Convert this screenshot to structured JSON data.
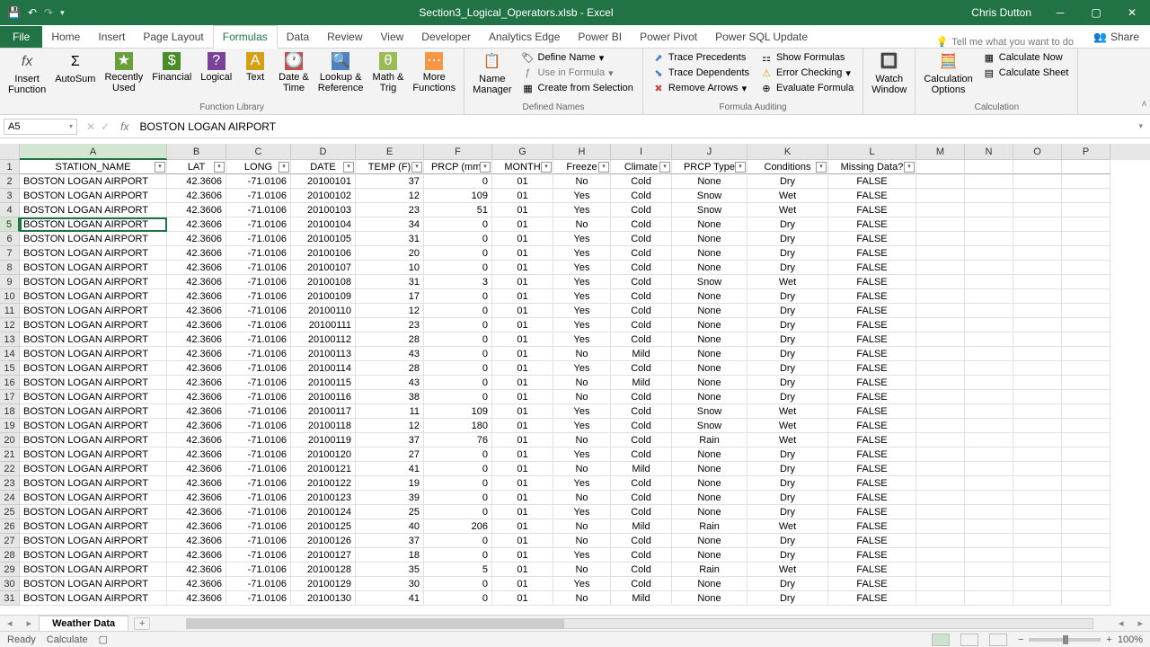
{
  "title": "Section3_Logical_Operators.xlsb - Excel",
  "user": "Chris Dutton",
  "tabs": {
    "file": "File",
    "home": "Home",
    "insert": "Insert",
    "pagelayout": "Page Layout",
    "formulas": "Formulas",
    "data": "Data",
    "review": "Review",
    "view": "View",
    "developer": "Developer",
    "analyticsedge": "Analytics Edge",
    "powerbi": "Power BI",
    "powerpivot": "Power Pivot",
    "powersql": "Power SQL Update"
  },
  "tellme": "Tell me what you want to do",
  "share": "Share",
  "ribbon": {
    "insertfn": "Insert\nFunction",
    "autosum": "AutoSum",
    "recent": "Recently\nUsed",
    "financial": "Financial",
    "logical": "Logical",
    "text": "Text",
    "datetime": "Date &\nTime",
    "lookup": "Lookup &\nReference",
    "math": "Math &\nTrig",
    "more": "More\nFunctions",
    "funclib": "Function Library",
    "namemgr": "Name\nManager",
    "defname": "Define Name",
    "useinf": "Use in Formula",
    "createsel": "Create from Selection",
    "defnames": "Defined Names",
    "traceprec": "Trace Precedents",
    "tracedep": "Trace Dependents",
    "removearr": "Remove Arrows",
    "showform": "Show Formulas",
    "errorchk": "Error Checking",
    "evalform": "Evaluate Formula",
    "formaudit": "Formula Auditing",
    "watchwin": "Watch\nWindow",
    "calcopt": "Calculation\nOptions",
    "calcnow": "Calculate Now",
    "calcsheet": "Calculate Sheet",
    "calcgrp": "Calculation"
  },
  "namebox": "A5",
  "formula": "BOSTON LOGAN AIRPORT",
  "colletters": [
    "A",
    "B",
    "C",
    "D",
    "E",
    "F",
    "G",
    "H",
    "I",
    "J",
    "K",
    "L",
    "M",
    "N",
    "O",
    "P"
  ],
  "headers": [
    "STATION_NAME",
    "LAT",
    "LONG",
    "DATE",
    "TEMP (F)",
    "PRCP (mm)",
    "MONTH",
    "Freeze",
    "Climate",
    "PRCP Type",
    "Conditions",
    "Missing Data?"
  ],
  "rows": [
    [
      "BOSTON LOGAN AIRPORT",
      "42.3606",
      "-71.0106",
      "20100101",
      "37",
      "0",
      "01",
      "No",
      "Cold",
      "None",
      "Dry",
      "FALSE"
    ],
    [
      "BOSTON LOGAN AIRPORT",
      "42.3606",
      "-71.0106",
      "20100102",
      "12",
      "109",
      "01",
      "Yes",
      "Cold",
      "Snow",
      "Wet",
      "FALSE"
    ],
    [
      "BOSTON LOGAN AIRPORT",
      "42.3606",
      "-71.0106",
      "20100103",
      "23",
      "51",
      "01",
      "Yes",
      "Cold",
      "Snow",
      "Wet",
      "FALSE"
    ],
    [
      "BOSTON LOGAN AIRPORT",
      "42.3606",
      "-71.0106",
      "20100104",
      "34",
      "0",
      "01",
      "No",
      "Cold",
      "None",
      "Dry",
      "FALSE"
    ],
    [
      "BOSTON LOGAN AIRPORT",
      "42.3606",
      "-71.0106",
      "20100105",
      "31",
      "0",
      "01",
      "Yes",
      "Cold",
      "None",
      "Dry",
      "FALSE"
    ],
    [
      "BOSTON LOGAN AIRPORT",
      "42.3606",
      "-71.0106",
      "20100106",
      "20",
      "0",
      "01",
      "Yes",
      "Cold",
      "None",
      "Dry",
      "FALSE"
    ],
    [
      "BOSTON LOGAN AIRPORT",
      "42.3606",
      "-71.0106",
      "20100107",
      "10",
      "0",
      "01",
      "Yes",
      "Cold",
      "None",
      "Dry",
      "FALSE"
    ],
    [
      "BOSTON LOGAN AIRPORT",
      "42.3606",
      "-71.0106",
      "20100108",
      "31",
      "3",
      "01",
      "Yes",
      "Cold",
      "Snow",
      "Wet",
      "FALSE"
    ],
    [
      "BOSTON LOGAN AIRPORT",
      "42.3606",
      "-71.0106",
      "20100109",
      "17",
      "0",
      "01",
      "Yes",
      "Cold",
      "None",
      "Dry",
      "FALSE"
    ],
    [
      "BOSTON LOGAN AIRPORT",
      "42.3606",
      "-71.0106",
      "20100110",
      "12",
      "0",
      "01",
      "Yes",
      "Cold",
      "None",
      "Dry",
      "FALSE"
    ],
    [
      "BOSTON LOGAN AIRPORT",
      "42.3606",
      "-71.0106",
      "20100111",
      "23",
      "0",
      "01",
      "Yes",
      "Cold",
      "None",
      "Dry",
      "FALSE"
    ],
    [
      "BOSTON LOGAN AIRPORT",
      "42.3606",
      "-71.0106",
      "20100112",
      "28",
      "0",
      "01",
      "Yes",
      "Cold",
      "None",
      "Dry",
      "FALSE"
    ],
    [
      "BOSTON LOGAN AIRPORT",
      "42.3606",
      "-71.0106",
      "20100113",
      "43",
      "0",
      "01",
      "No",
      "Mild",
      "None",
      "Dry",
      "FALSE"
    ],
    [
      "BOSTON LOGAN AIRPORT",
      "42.3606",
      "-71.0106",
      "20100114",
      "28",
      "0",
      "01",
      "Yes",
      "Cold",
      "None",
      "Dry",
      "FALSE"
    ],
    [
      "BOSTON LOGAN AIRPORT",
      "42.3606",
      "-71.0106",
      "20100115",
      "43",
      "0",
      "01",
      "No",
      "Mild",
      "None",
      "Dry",
      "FALSE"
    ],
    [
      "BOSTON LOGAN AIRPORT",
      "42.3606",
      "-71.0106",
      "20100116",
      "38",
      "0",
      "01",
      "No",
      "Cold",
      "None",
      "Dry",
      "FALSE"
    ],
    [
      "BOSTON LOGAN AIRPORT",
      "42.3606",
      "-71.0106",
      "20100117",
      "11",
      "109",
      "01",
      "Yes",
      "Cold",
      "Snow",
      "Wet",
      "FALSE"
    ],
    [
      "BOSTON LOGAN AIRPORT",
      "42.3606",
      "-71.0106",
      "20100118",
      "12",
      "180",
      "01",
      "Yes",
      "Cold",
      "Snow",
      "Wet",
      "FALSE"
    ],
    [
      "BOSTON LOGAN AIRPORT",
      "42.3606",
      "-71.0106",
      "20100119",
      "37",
      "76",
      "01",
      "No",
      "Cold",
      "Rain",
      "Wet",
      "FALSE"
    ],
    [
      "BOSTON LOGAN AIRPORT",
      "42.3606",
      "-71.0106",
      "20100120",
      "27",
      "0",
      "01",
      "Yes",
      "Cold",
      "None",
      "Dry",
      "FALSE"
    ],
    [
      "BOSTON LOGAN AIRPORT",
      "42.3606",
      "-71.0106",
      "20100121",
      "41",
      "0",
      "01",
      "No",
      "Mild",
      "None",
      "Dry",
      "FALSE"
    ],
    [
      "BOSTON LOGAN AIRPORT",
      "42.3606",
      "-71.0106",
      "20100122",
      "19",
      "0",
      "01",
      "Yes",
      "Cold",
      "None",
      "Dry",
      "FALSE"
    ],
    [
      "BOSTON LOGAN AIRPORT",
      "42.3606",
      "-71.0106",
      "20100123",
      "39",
      "0",
      "01",
      "No",
      "Cold",
      "None",
      "Dry",
      "FALSE"
    ],
    [
      "BOSTON LOGAN AIRPORT",
      "42.3606",
      "-71.0106",
      "20100124",
      "25",
      "0",
      "01",
      "Yes",
      "Cold",
      "None",
      "Dry",
      "FALSE"
    ],
    [
      "BOSTON LOGAN AIRPORT",
      "42.3606",
      "-71.0106",
      "20100125",
      "40",
      "206",
      "01",
      "No",
      "Mild",
      "Rain",
      "Wet",
      "FALSE"
    ],
    [
      "BOSTON LOGAN AIRPORT",
      "42.3606",
      "-71.0106",
      "20100126",
      "37",
      "0",
      "01",
      "No",
      "Cold",
      "None",
      "Dry",
      "FALSE"
    ],
    [
      "BOSTON LOGAN AIRPORT",
      "42.3606",
      "-71.0106",
      "20100127",
      "18",
      "0",
      "01",
      "Yes",
      "Cold",
      "None",
      "Dry",
      "FALSE"
    ],
    [
      "BOSTON LOGAN AIRPORT",
      "42.3606",
      "-71.0106",
      "20100128",
      "35",
      "5",
      "01",
      "No",
      "Cold",
      "Rain",
      "Wet",
      "FALSE"
    ],
    [
      "BOSTON LOGAN AIRPORT",
      "42.3606",
      "-71.0106",
      "20100129",
      "30",
      "0",
      "01",
      "Yes",
      "Cold",
      "None",
      "Dry",
      "FALSE"
    ],
    [
      "BOSTON LOGAN AIRPORT",
      "42.3606",
      "-71.0106",
      "20100130",
      "41",
      "0",
      "01",
      "No",
      "Mild",
      "None",
      "Dry",
      "FALSE"
    ]
  ],
  "sheet": "Weather Data",
  "status": {
    "ready": "Ready",
    "calc": "Calculate",
    "zoom": "100%"
  }
}
